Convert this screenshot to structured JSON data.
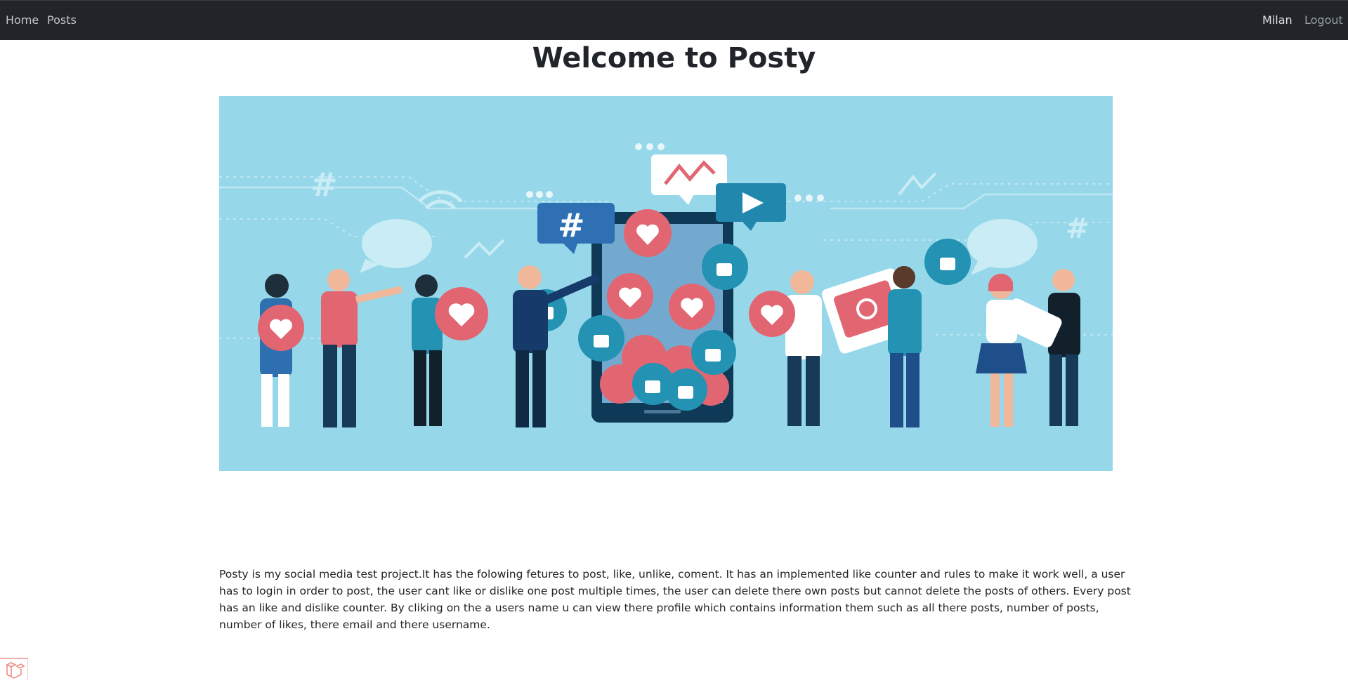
{
  "navbar": {
    "left_links": [
      "Home",
      "Posts"
    ],
    "user_name": "Milan",
    "logout_label": "Logout"
  },
  "page": {
    "title": "Welcome to Posty",
    "description": "Posty is my social media test project.It has the folowing fetures to post, like, unlike, coment. It has an implemented like counter and rules to make it work well, a user has to login in order to post, the user cant like or dislike one post multiple times, the user can delete there own posts but cannot delete the posts of others. Every post has an like and dislike counter. By cliking on the a users name u can view there profile which contains information them such as all there posts, number of posts, number of likes, there email and there username."
  },
  "hero": {
    "background": "#96d8ea",
    "icons": [
      "hashtag-icon",
      "play-icon",
      "chart-line-icon",
      "heart-icon",
      "thumbs-up-icon",
      "camera-icon",
      "wifi-icon",
      "speech-bubble-icon"
    ]
  },
  "colors": {
    "navbar_bg": "#212529",
    "heart_red": "#e26672",
    "like_blue": "#2492b3",
    "phone_dark": "#0f3a57"
  },
  "footer": {
    "icon": "laravel-logo-icon"
  }
}
